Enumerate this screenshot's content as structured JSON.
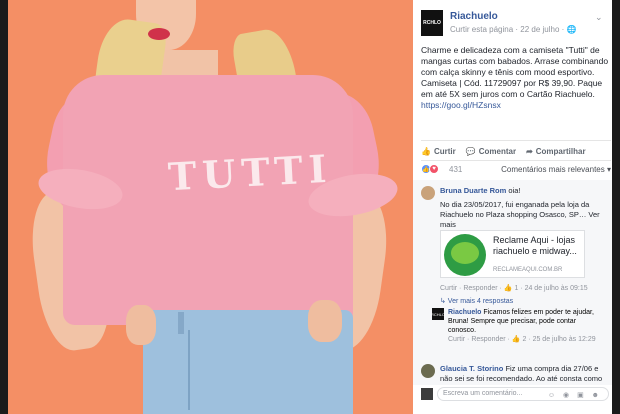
{
  "post": {
    "page_name": "Riachuelo",
    "logo_text": "RCHLO",
    "meta": "Curtir esta página · 22 de julho · 🌐",
    "chevron": "⌄",
    "text": "Charme e delicadeza com a camiseta \"Tutti\" de mangas curtas com babados. Arrase combinando com calça skinny e tênis com mood esportivo. Camiseta | Cód. 11729097 por R$ 39,90. Paque em até 5X sem juros com o Cartão Riachuelo.",
    "link": "https://goo.gl/HZsnsx",
    "shirt_text": "TUTTI"
  },
  "actions": {
    "like": "Curtir",
    "comment": "Comentar",
    "share": "Compartilhar"
  },
  "reactions": {
    "count": "431",
    "sort_label": "Comentários mais relevantes ▾"
  },
  "comments": [
    {
      "name": "Bruna Duarte Rom",
      "text": "oia!"
    },
    {
      "body": "No dia 23/05/2017, fui enganada pela loja da Riachuelo no Plaza shopping Osasco, SP… Ver mais",
      "actions": "Curtir · Responder · 👍 1 · 24 de julho às 09:15"
    }
  ],
  "link_card": {
    "title": "Reclame Aqui - lojas riachuelo e midway...",
    "domain": "RECLAMEAQUI.COM.BR"
  },
  "more_replies": "↳ Ver mais 4 respostas",
  "reply": {
    "name": "Riachuelo",
    "text": "Ficamos felizes em poder te ajudar, Bruna! Sempre que precisar, pode contar conosco.",
    "actions": "Curtir · Responder · 👍 2 · 25 de julho às 12:29"
  },
  "comment3": {
    "name": "Glaucia T. Storino",
    "text": "Fiz uma compra dia 27/06 e não sei se foi recomendado. Ao até consta como"
  },
  "input": {
    "placeholder": "Escreva um comentário...",
    "icons": "☺ ◉ ▣ ☻"
  },
  "colors": {
    "photo_bg": "#f48f65",
    "shirt": "#f2a3b4",
    "link": "#365899"
  }
}
